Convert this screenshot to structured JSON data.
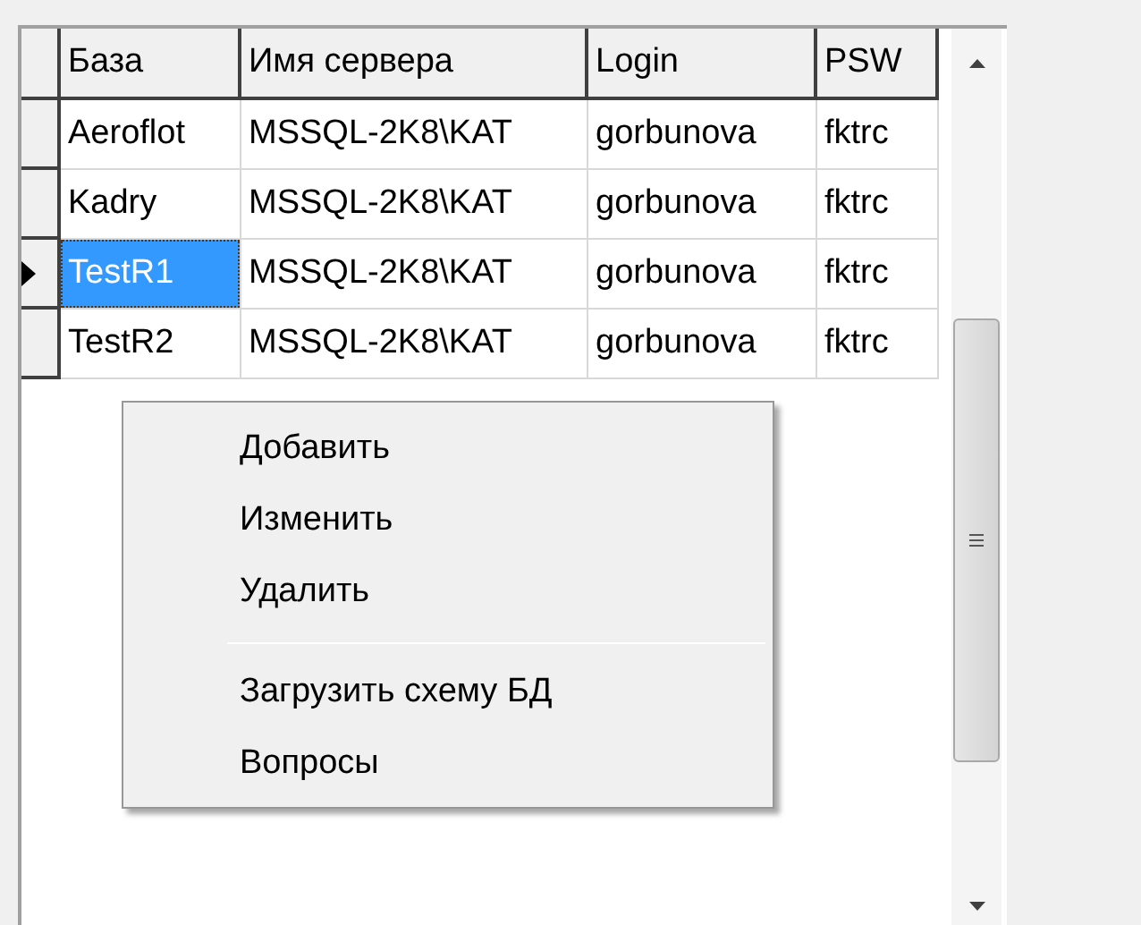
{
  "table": {
    "columns": [
      "База",
      "Имя сервера",
      "Login",
      "PSW"
    ],
    "rows": [
      {
        "cells": [
          "Aeroflot",
          "MSSQL-2K8\\KAT",
          "gorbunova",
          "fktrc"
        ],
        "selected": false
      },
      {
        "cells": [
          "Kadry",
          "MSSQL-2K8\\KAT",
          "gorbunova",
          "fktrc"
        ],
        "selected": false
      },
      {
        "cells": [
          "TestR1",
          "MSSQL-2K8\\KAT",
          "gorbunova",
          "fktrc"
        ],
        "selected": true
      },
      {
        "cells": [
          "TestR2",
          "MSSQL-2K8\\KAT",
          "gorbunova",
          "fktrc"
        ],
        "selected": false
      }
    ]
  },
  "context_menu": {
    "items": [
      {
        "kind": "item",
        "label": "Добавить"
      },
      {
        "kind": "item",
        "label": "Изменить"
      },
      {
        "kind": "item",
        "label": "Удалить"
      },
      {
        "kind": "separator"
      },
      {
        "kind": "item",
        "label": "Загрузить схему БД"
      },
      {
        "kind": "item",
        "label": "Вопросы"
      }
    ]
  }
}
